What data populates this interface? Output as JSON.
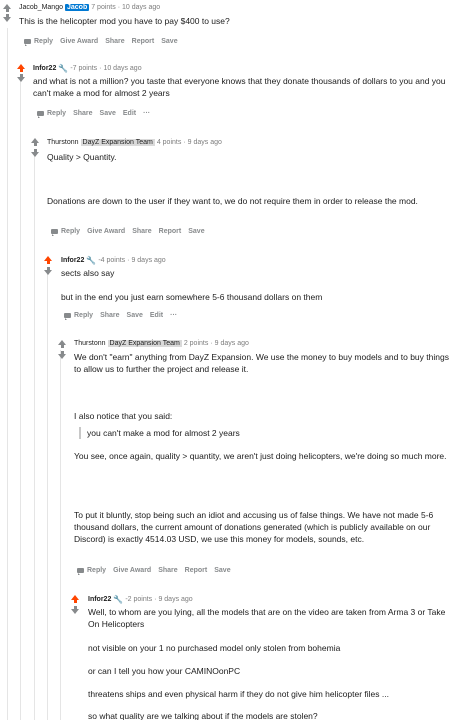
{
  "comments": [
    {
      "author": "Jacob_Mango",
      "flair": "Jacob",
      "points": "7 points",
      "age": "· 10 days ago",
      "body": [
        "This is the helicopter mod you have to pay $400 to use?"
      ],
      "actions": [
        "Reply",
        "Give Award",
        "Share",
        "Report",
        "Save"
      ]
    },
    {
      "author": "Infor22",
      "points": "-7 points",
      "age": "· 10 days ago",
      "body": [
        "and what is not a million? you taste that everyone knows that they donate thousands of dollars to you and you can't make a mod for almost 2 years"
      ],
      "actions": [
        "Reply",
        "Share",
        "Save",
        "Edit",
        "···"
      ]
    },
    {
      "author": "Thurstonn",
      "flair": "DayZ Expansion Team",
      "points": "4 points",
      "age": "· 9 days ago",
      "body": [
        "Quality > Quantity.",
        "Donations are down to the user if they want to, we do not require them in order to release the mod."
      ],
      "actions": [
        "Reply",
        "Give Award",
        "Share",
        "Report",
        "Save"
      ]
    },
    {
      "author": "Infor22",
      "points": "-4 points",
      "age": "· 9 days ago",
      "body": [
        "sects also say",
        "but in the end you just earn somewhere 5-6 thousand dollars on them"
      ],
      "actions": [
        "Reply",
        "Share",
        "Save",
        "Edit",
        "···"
      ]
    },
    {
      "author": "Thurstonn",
      "flair": "DayZ Expansion Team",
      "points": "2 points",
      "age": "· 9 days ago",
      "body": [
        "We don't \"earn\" anything from DayZ Expansion. We use the money to buy models and to buy things to allow us to further the project and release it.",
        "I also notice that you said:",
        "you can't make a mod for almost 2 years",
        "You see, once again, quality > quantity, we aren't just doing helicopters, we're doing so much more.",
        "To put it bluntly, stop being such an idiot and accusing us of false things. We have not made 5-6 thousand dollars, the current amount of donations generated (which is publicly available on our Discord) is exactly 4514.03 USD, we use this money for models, sounds, etc."
      ],
      "actions": [
        "Reply",
        "Give Award",
        "Share",
        "Report",
        "Save"
      ]
    },
    {
      "author": "Infor22",
      "points": "-2 points",
      "age": "· 9 days ago",
      "body": [
        "Well, to whom are you lying, all the models that are on the video are taken from Arma 3 or Take On Helicopters",
        "not visible on your 1 no purchased model only stolen from bohemia",
        "or can I tell you how your CAMINOonPC",
        "threatens ships and even physical harm if they do not give him helicopter files ...",
        "so what quality are we talking about if the models are stolen?"
      ]
    }
  ]
}
